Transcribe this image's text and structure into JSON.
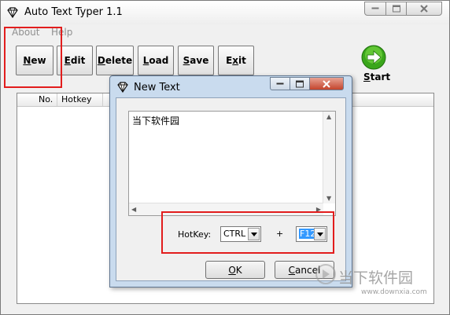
{
  "window": {
    "title": "Auto Text Typer 1.1",
    "icon": "diamond-icon"
  },
  "menu": [
    "About",
    "Help"
  ],
  "toolbar": {
    "new": {
      "pre": "",
      "mn": "N",
      "post": "ew"
    },
    "edit": {
      "pre": "",
      "mn": "E",
      "post": "dit"
    },
    "delete": {
      "pre": "",
      "mn": "D",
      "post": "elete"
    },
    "load": {
      "pre": "",
      "mn": "L",
      "post": "oad"
    },
    "save": {
      "pre": "",
      "mn": "S",
      "post": "ave"
    },
    "exit": {
      "pre": "E",
      "mn": "x",
      "post": "it"
    },
    "start": {
      "pre": "",
      "mn": "S",
      "post": "tart",
      "icon": "green-arrow-icon"
    }
  },
  "list": {
    "columns": [
      "No.",
      "Hotkey"
    ]
  },
  "dialog": {
    "title": "New Text",
    "icon": "diamond-icon",
    "text": "当下软件园",
    "hotkey_label": "HotKey:",
    "modifier": "CTRL",
    "plus": "+",
    "key": "F12",
    "ok": {
      "mn": "O",
      "post": "K"
    },
    "cancel": {
      "pre": "",
      "mn": "C",
      "post": "ancel"
    }
  },
  "highlight_color": "#e21d1d",
  "watermark": {
    "text": "当下软件园",
    "url": "www.downxia.com"
  }
}
